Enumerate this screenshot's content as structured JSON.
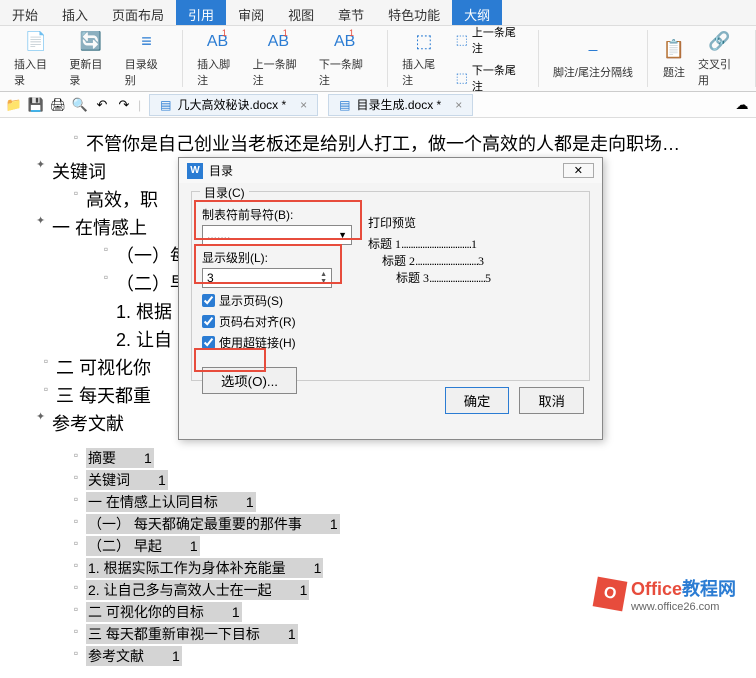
{
  "tabs": [
    "开始",
    "插入",
    "页面布局",
    "引用",
    "审阅",
    "视图",
    "章节",
    "特色功能",
    "大纲"
  ],
  "active_tab": 3,
  "ribbon": {
    "insert_toc": "插入目录",
    "update_toc": "更新目录",
    "toc_level": "目录级别",
    "insert_footnote": "插入脚注",
    "prev_footnote": "上一条脚注",
    "next_footnote": "下一条脚注",
    "insert_endnote": "插入尾注",
    "prev_endnote": "上一条尾注",
    "next_endnote": "下一条尾注",
    "separator": "脚注/尾注分隔线",
    "caption": "题注",
    "crossref": "交叉引用"
  },
  "doctabs": [
    {
      "name": "几大高效秘诀.docx *"
    },
    {
      "name": "目录生成.docx *"
    }
  ],
  "doc": {
    "l1": "不管你是自己创业当老板还是给别人打工，做一个高效的人都是走向职场…",
    "l2": "关键词",
    "l3": "高效，职",
    "l4": "一 在情感上",
    "l5": "（一）每",
    "l6": "（二）早",
    "l7": "1. 根据",
    "l8": "2. 让自",
    "l9": "二 可视化你",
    "l10": "三 每天都重",
    "l11": "参考文献",
    "lines": [
      {
        "t": "摘要",
        "n": "1"
      },
      {
        "t": "关键词",
        "n": "1"
      },
      {
        "t": "一 在情感上认同目标",
        "n": "1",
        "ind": 1
      },
      {
        "t": "（一） 每天都确定最重要的那件事",
        "n": "1",
        "ind": 1
      },
      {
        "t": "（二） 早起",
        "n": "1",
        "ind": 1
      },
      {
        "t": "1. 根据实际工作为身体补充能量",
        "n": "1",
        "ind": 1
      },
      {
        "t": "2. 让自己多与高效人士在一起",
        "n": "1",
        "ind": 1
      },
      {
        "t": "二 可视化你的目标",
        "n": "1",
        "ind": 1
      },
      {
        "t": "三 每天都重新审视一下目标",
        "n": "1",
        "ind": 1
      },
      {
        "t": "参考文献",
        "n": "1",
        "ind": 1
      }
    ]
  },
  "dialog": {
    "title": "目录",
    "group": "目录(C)",
    "tab_leader_lbl": "制表符前导符(B):",
    "tab_leader_val": ".......",
    "show_level_lbl": "显示级别(L):",
    "show_level_val": "3",
    "chk_pages": "显示页码(S)",
    "chk_right": "页码右对齐(R)",
    "chk_hyper": "使用超链接(H)",
    "options": "选项(O)...",
    "preview_lbl": "打印预览",
    "preview": [
      {
        "label": "标题 1",
        "page": "1",
        "ind": 0
      },
      {
        "label": "标题 2",
        "page": "3",
        "ind": 1
      },
      {
        "label": "标题 3",
        "page": "5",
        "ind": 2
      }
    ],
    "ok": "确定",
    "cancel": "取消"
  },
  "watermark": {
    "brand_o": "Office",
    "brand_b": "教程网",
    "url": "www.office26.com"
  }
}
